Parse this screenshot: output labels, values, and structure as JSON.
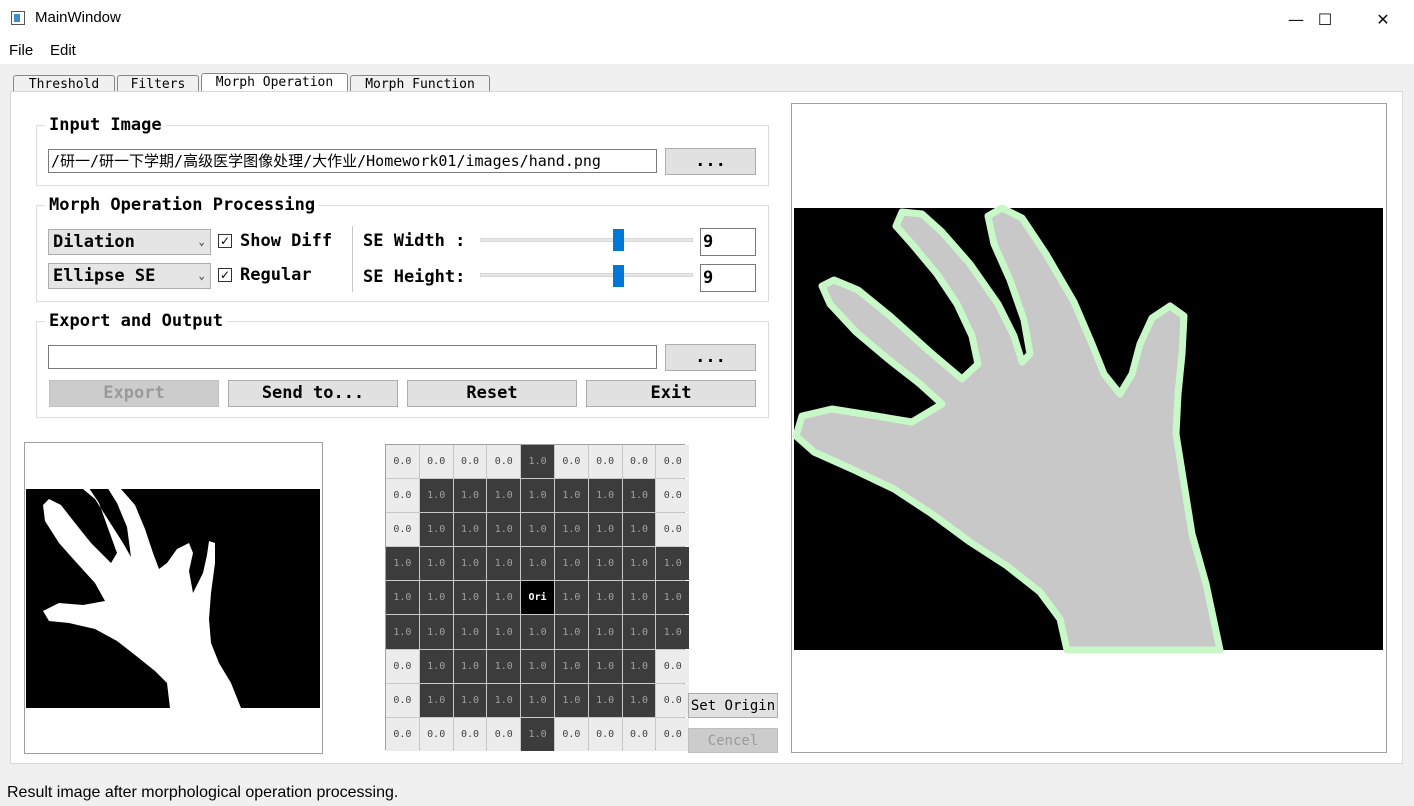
{
  "window": {
    "title": "MainWindow",
    "controls": {
      "minimize": "—",
      "maximize": "☐",
      "close": "✕"
    }
  },
  "menu": [
    "File",
    "Edit"
  ],
  "tabs": [
    {
      "label": "Threshold",
      "active": false
    },
    {
      "label": "Filters",
      "active": false
    },
    {
      "label": "Morph Operation",
      "active": true
    },
    {
      "label": "Morph Function",
      "active": false
    }
  ],
  "input_image": {
    "title": "Input Image",
    "path": "/研一/研一下学期/高级医学图像处理/大作业/Homework01/images/hand.png",
    "browse_label": "..."
  },
  "processing": {
    "title": "Morph Operation Processing",
    "operation": "Dilation",
    "se_shape": "Ellipse SE",
    "show_diff_label": "Show Diff",
    "show_diff_checked": true,
    "regular_label": "Regular",
    "regular_checked": true,
    "se_width_label": "SE Width :",
    "se_width": "9",
    "se_height_label": "SE Height:",
    "se_height": "9",
    "slider_fraction": 0.65
  },
  "export": {
    "title": "Export and Output",
    "path": "",
    "browse_label": "...",
    "export_label": "Export",
    "send_label": "Send to...",
    "reset_label": "Reset",
    "exit_label": "Exit"
  },
  "se_matrix": {
    "values": [
      [
        0,
        0,
        0,
        0,
        1,
        0,
        0,
        0,
        0
      ],
      [
        0,
        1,
        1,
        1,
        1,
        1,
        1,
        1,
        0
      ],
      [
        0,
        1,
        1,
        1,
        1,
        1,
        1,
        1,
        0
      ],
      [
        1,
        1,
        1,
        1,
        1,
        1,
        1,
        1,
        1
      ],
      [
        1,
        1,
        1,
        1,
        1,
        1,
        1,
        1,
        1
      ],
      [
        1,
        1,
        1,
        1,
        1,
        1,
        1,
        1,
        1
      ],
      [
        0,
        1,
        1,
        1,
        1,
        1,
        1,
        1,
        0
      ],
      [
        0,
        1,
        1,
        1,
        1,
        1,
        1,
        1,
        0
      ],
      [
        0,
        0,
        0,
        0,
        1,
        0,
        0,
        0,
        0
      ]
    ],
    "zero_label": "0.0",
    "one_label": "1.0",
    "origin_label": "Ori",
    "origin": [
      4,
      4
    ]
  },
  "set_origin_label": "Set Origin",
  "cancel_label": "Cencel",
  "status_text": "Result image after morphological operation processing.",
  "colors": {
    "accent": "#0078d7",
    "hand_fill": "#c8c8c8",
    "diff_outline": "#c8f7c8"
  }
}
